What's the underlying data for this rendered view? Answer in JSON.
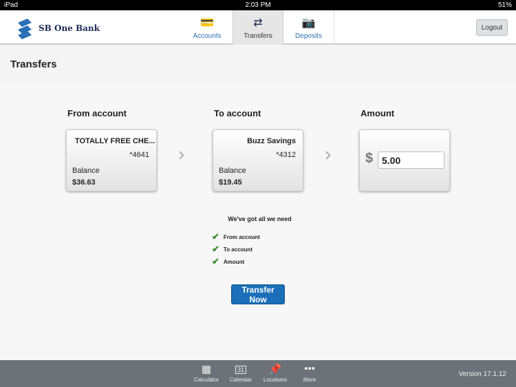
{
  "status": {
    "device": "iPad",
    "time": "2:03 PM",
    "battery": "51%"
  },
  "header": {
    "bank": "SB One Bank",
    "tabs": [
      {
        "label": "Accounts"
      },
      {
        "label": "Transfers"
      },
      {
        "label": "Deposits"
      }
    ],
    "logout": "Logout"
  },
  "page_title": "Transfers",
  "from": {
    "heading": "From account",
    "name": "TOTALLY FREE CHE...",
    "number": "*4641",
    "balance_label": "Balance",
    "balance": "$36.63"
  },
  "to": {
    "heading": "To account",
    "name": "Buzz Savings",
    "number": "*4312",
    "balance_label": "Balance",
    "balance": "$19.45"
  },
  "amount": {
    "heading": "Amount",
    "currency": "$",
    "value": "5.00"
  },
  "checklist": {
    "heading": "We've got all we need",
    "items": [
      "From account",
      "To account",
      "Amount"
    ]
  },
  "transfer_button": "Transfer Now",
  "footer": {
    "items": [
      "Calculator",
      "Calendar",
      "Locations",
      "More"
    ],
    "calendar_day": "31",
    "version": "Version 17.1.12"
  }
}
